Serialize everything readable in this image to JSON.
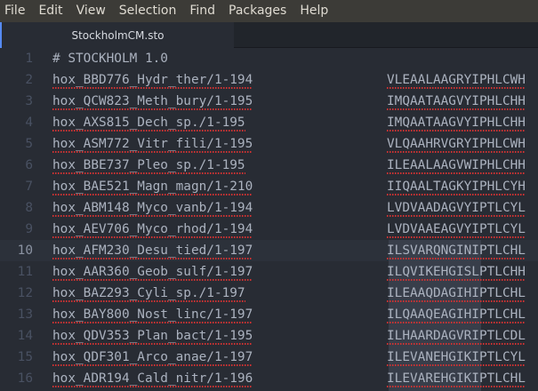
{
  "menubar": {
    "items": [
      "File",
      "Edit",
      "View",
      "Selection",
      "Find",
      "Packages",
      "Help"
    ]
  },
  "tabs": [
    {
      "label": "StockholmCM.sto",
      "active": true
    }
  ],
  "editor": {
    "cursor_line": 10,
    "lines": [
      {
        "num": "1",
        "name": "# STOCKHOLM 1.0",
        "seq": ""
      },
      {
        "num": "2",
        "name": "hox_BBD776_Hydr_ther/1-194",
        "seq": "VLEAALAAGRYIPHLCWH"
      },
      {
        "num": "3",
        "name": "hox_QCW823_Meth_bury/1-195",
        "seq": "IMQAATAAGVYIPHLCHH"
      },
      {
        "num": "4",
        "name": "hox_AXS815_Dech_sp./1-195",
        "seq": "IMQAATAAGVYIPHLCHH"
      },
      {
        "num": "5",
        "name": "hox_ASM772_Vitr_fili/1-195",
        "seq": "VLQAAHRVGRYIPHLCWH"
      },
      {
        "num": "6",
        "name": "hox_BBE737_Pleo_sp./1-195",
        "seq": "ILEAALAAGVWIPHLCHH"
      },
      {
        "num": "7",
        "name": "hox_BAE521_Magn_magn/1-210",
        "seq": "IIQAALTAGKYIPHLCYH"
      },
      {
        "num": "8",
        "name": "hox_ABM148_Myco_vanb/1-194",
        "seq": "LVDVAADAGVYIPTLCYL"
      },
      {
        "num": "9",
        "name": "hox_AEV706_Myco_rhod/1-194",
        "seq": "LVDVAAEAGVYIPTLCYL"
      },
      {
        "num": "10",
        "name": "hox_AFM230_Desu_tied/1-197",
        "seq": "ILSVARQNGINIPTLCHL"
      },
      {
        "num": "11",
        "name": "hox_AAR360_Geob_sulf/1-197",
        "seq": "ILQVIKEHGISLPTLCHH"
      },
      {
        "num": "12",
        "name": "hox_BAZ293_Cyli_sp./1-197",
        "seq": "ILEAAQDAGIHIPTLCHL"
      },
      {
        "num": "13",
        "name": "hox_BAY800_Nost_linc/1-197",
        "seq": "ILQAAQEAGIHIPTLCHL"
      },
      {
        "num": "14",
        "name": "hox_QDV353_Plan_bact/1-195",
        "seq": "ILHAARDAGVRIPTLCDL"
      },
      {
        "num": "15",
        "name": "hox_QDF301_Arco_anae/1-197",
        "seq": "ILEVANEHGIKIPTLCYL"
      },
      {
        "num": "16",
        "name": "hox_ADR194_Cald_nitr/1-196",
        "seq": "ILEVAREHGIKIPTLCHL"
      }
    ]
  },
  "colors": {
    "background": "#282c34",
    "menubar": "#3c3b37",
    "text": "#abb2bf",
    "line_number": "#495162",
    "spellcheck_underline": "#d23232",
    "selection": "#3e4451",
    "tab_accent": "#568af2"
  }
}
